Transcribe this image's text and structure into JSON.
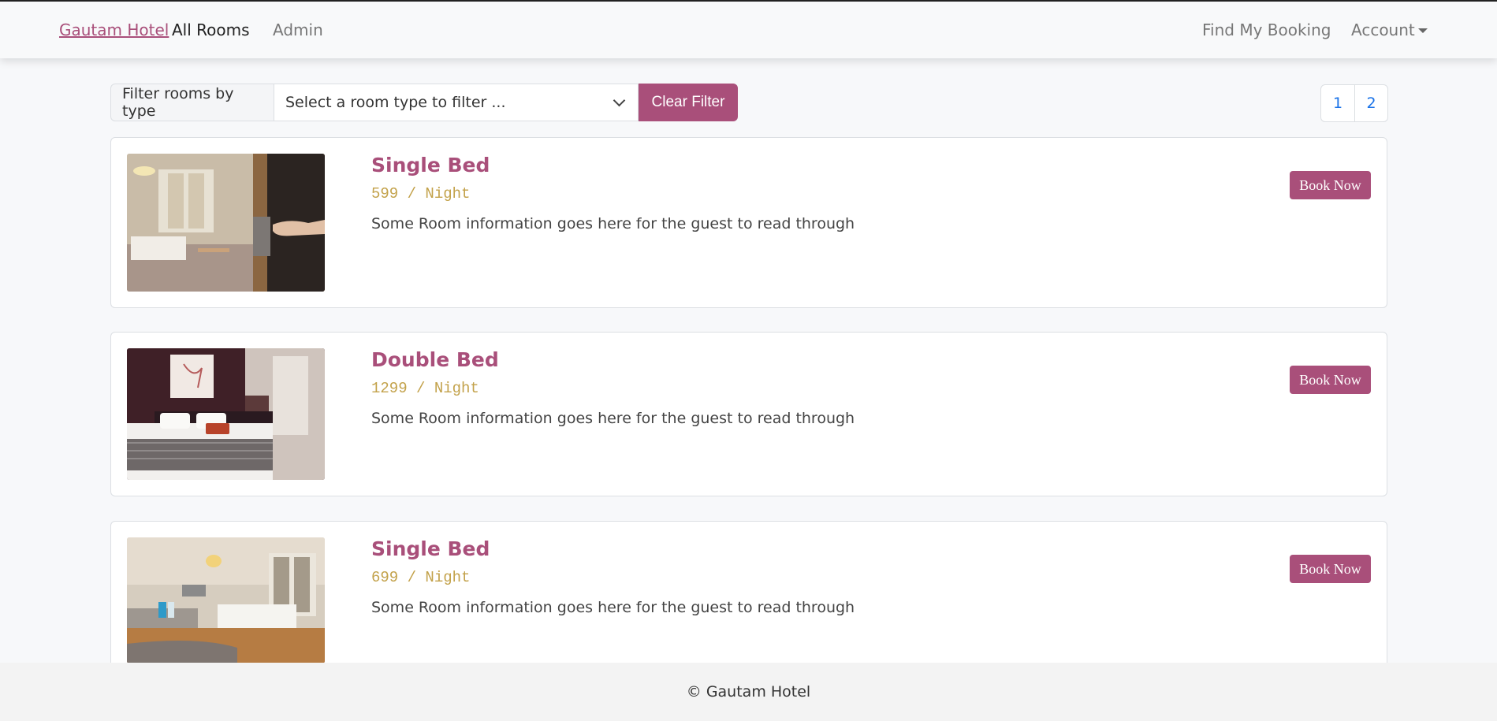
{
  "navbar": {
    "brand": "Gautam Hotel",
    "links": [
      "All Rooms",
      "Admin"
    ],
    "right_links": [
      "Find My Booking",
      "Account"
    ]
  },
  "filter": {
    "label": "Filter rooms by type",
    "select_value": "Select a room type to filter ...",
    "clear_label": "Clear Filter"
  },
  "pagination": [
    "1",
    "2"
  ],
  "rooms": [
    {
      "title": "Single Bed",
      "price": "599 / Night",
      "description": "Some Room information goes here for the guest to read through",
      "book_label": "Book Now"
    },
    {
      "title": "Double Bed",
      "price": "1299 / Night",
      "description": "Some Room information goes here for the guest to read through",
      "book_label": "Book Now"
    },
    {
      "title": "Single Bed",
      "price": "699 / Night",
      "description": "Some Room information goes here for the guest to read through",
      "book_label": "Book Now"
    }
  ],
  "footer": {
    "text": "© Gautam Hotel"
  },
  "colors": {
    "accent": "#a94f7a",
    "price": "#c3a24b",
    "link": "#1a73e8"
  }
}
